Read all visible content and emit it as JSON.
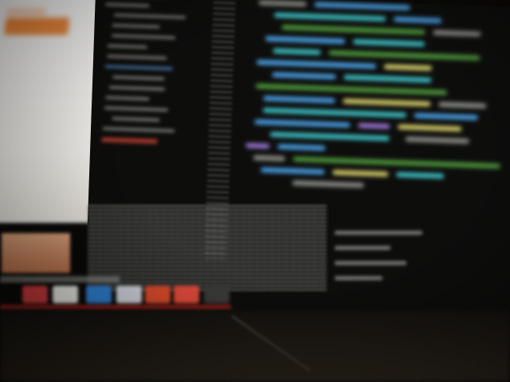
{
  "scene": {
    "description_colors": {
      "background": "#0a0908",
      "left_window": "#ffffff",
      "accent_orange": "#f08a3a",
      "code_blue": "#4aa3e8",
      "code_teal": "#3ec4c8",
      "code_yellow": "#d8d06a",
      "code_green": "#4f9a3c",
      "code_purple": "#9b78d8",
      "dock_red": "#c2402e"
    },
    "dock_icons": [
      {
        "name": "red-app-icon",
        "color": "#c83a3a"
      },
      {
        "name": "white-app-icon",
        "color": "#e8e8e2"
      },
      {
        "name": "blue-app-icon",
        "color": "#2e7fd0"
      },
      {
        "name": "grey-app-icon",
        "color": "#cfd3da"
      },
      {
        "name": "orange-app-icon",
        "color": "#d94a2a"
      },
      {
        "name": "red-white-app-icon",
        "color": "#e04a3a"
      },
      {
        "name": "dark-app-icon",
        "color": "#3a3a38"
      }
    ]
  }
}
